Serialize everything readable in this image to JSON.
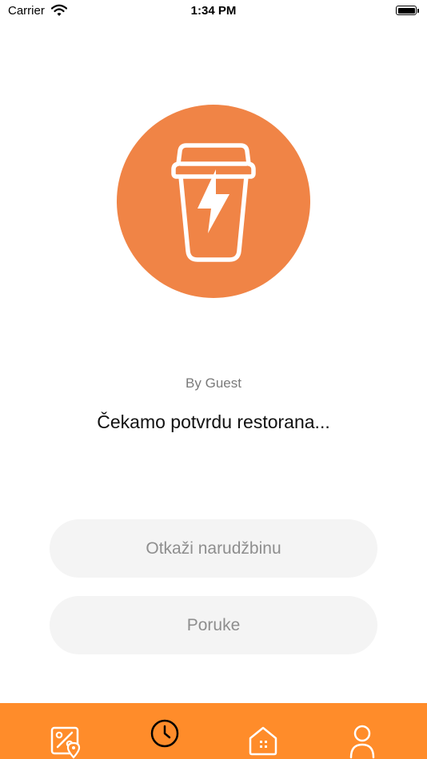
{
  "status_bar": {
    "carrier": "Carrier",
    "time": "1:34 PM",
    "icons": [
      "wifi-icon",
      "battery-icon"
    ]
  },
  "hero": {
    "icon": "coffee-cup-lightning-icon",
    "circle_color": "#F08446"
  },
  "order": {
    "by_line": "By Guest",
    "status_message": "Čekamo potvrdu restorana..."
  },
  "actions": {
    "cancel_label": "Otkaži narudžbinu",
    "messages_label": "Poruke"
  },
  "tab_bar": {
    "color": "#FF8C2A",
    "items": [
      {
        "icon": "map-discount-icon",
        "active": false
      },
      {
        "icon": "clock-icon",
        "active": true
      },
      {
        "icon": "home-icon",
        "active": false
      },
      {
        "icon": "user-icon",
        "active": false
      }
    ]
  }
}
